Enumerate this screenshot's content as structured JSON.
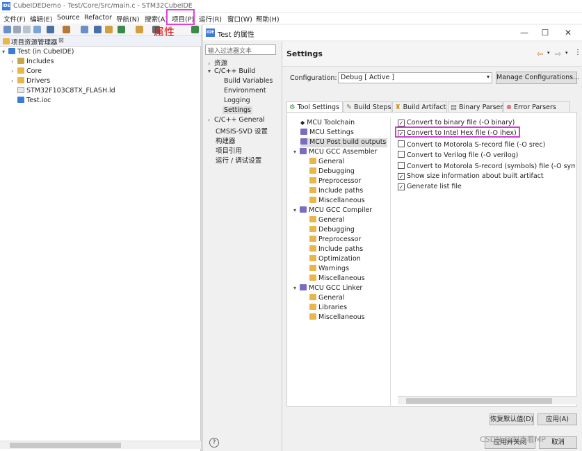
{
  "app": {
    "title": "CubeIDEDemo - Test/Core/Src/main.c - STM32CubeIDE",
    "icon_label": "IDE",
    "menu": [
      "文件(F)",
      "编辑(E)",
      "Source",
      "Refactor",
      "导航(N)",
      "搜索(A)",
      "项目(P)",
      "运行(R)",
      "窗口(W)",
      "帮助(H)"
    ],
    "annotation": "属性"
  },
  "explorer": {
    "title": "项目资源管理器",
    "items": [
      {
        "label": "Test (in CubeIDE)",
        "icon": "project-icon"
      },
      {
        "label": "Includes",
        "icon": "includes-icon"
      },
      {
        "label": "Core",
        "icon": "folder-icon"
      },
      {
        "label": "Drivers",
        "icon": "folder-icon"
      },
      {
        "label": "STM32F103C8TX_FLASH.ld",
        "icon": "file-icon"
      },
      {
        "label": "Test.ioc",
        "icon": "ioc-icon"
      }
    ]
  },
  "dialog": {
    "title": "Test 的属性",
    "filter_placeholder": "输入过滤器文本",
    "nav": [
      "资源",
      "C/C++ Build",
      "Build Variables",
      "Environment",
      "Logging",
      "Settings",
      "C/C++ General",
      "CMSIS-SVD 设置",
      "构建器",
      "项目引用",
      "运行 / 调试设置"
    ],
    "header": "Settings",
    "config_label": "Configuration:",
    "config_value": "Debug  [ Active ]",
    "manage_button": "Manage Configurations...",
    "tabs": [
      "Tool Settings",
      "Build Steps",
      "Build Artifact",
      "Binary Parsers",
      "Error Parsers"
    ],
    "tool_tree": [
      "MCU Toolchain",
      "MCU Settings",
      "MCU Post build outputs",
      "MCU GCC Assembler",
      "General",
      "Debugging",
      "Preprocessor",
      "Include paths",
      "Miscellaneous",
      "MCU GCC Compiler",
      "General",
      "Debugging",
      "Preprocessor",
      "Include paths",
      "Optimization",
      "Warnings",
      "Miscellaneous",
      "MCU GCC Linker",
      "General",
      "Libraries",
      "Miscellaneous"
    ],
    "options": [
      {
        "label": "Convert to binary file (-O binary)",
        "checked": true
      },
      {
        "label": "Convert to Intel Hex file (-O ihex)",
        "checked": true
      },
      {
        "label": "Convert to Motorola S-record file (-O srec)",
        "checked": false
      },
      {
        "label": "Convert to Verilog file (-O verilog)",
        "checked": false
      },
      {
        "label": "Convert to Motorola S-record (symbols) file (-O symbo",
        "checked": false
      },
      {
        "label": "Show size information about built artifact",
        "checked": true
      },
      {
        "label": "Generate list file",
        "checked": true
      }
    ],
    "restore_button": "恢复默认值(D)",
    "apply_button": "应用(A)",
    "apply_close_button": "应用并关闭",
    "cancel_button": "取消",
    "help_label": "?"
  },
  "watermark": "CSDN @刘森看MP"
}
